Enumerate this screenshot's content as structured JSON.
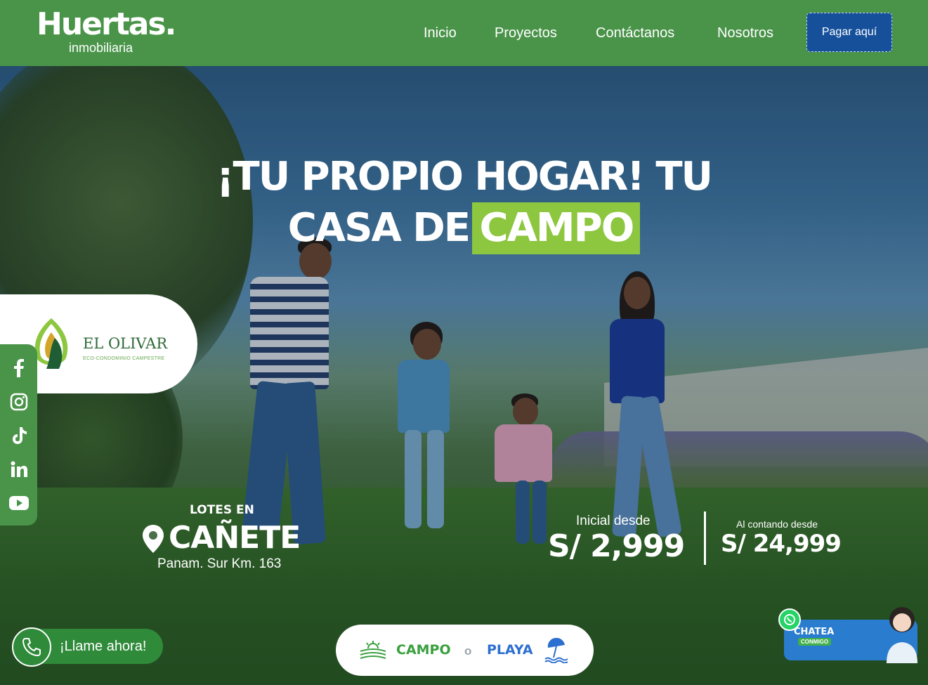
{
  "header": {
    "logo_main": "Huertas.",
    "logo_sub": "inmobiliaria",
    "nav": [
      "Inicio",
      "Proyectos",
      "Contáctanos",
      "Nosotros"
    ],
    "pay_button": "Pagar aquí"
  },
  "hero": {
    "headline_line1": "¡TU PROPIO HOGAR! TU",
    "headline_line2_prefix": "CASA DE",
    "headline_highlight": "CAMPO"
  },
  "project": {
    "name": "EL OLIVAR",
    "subtitle": "ECO-CONDOMINIO CAMPESTRE"
  },
  "social": [
    "facebook-icon",
    "instagram-icon",
    "tiktok-icon",
    "linkedin-icon",
    "youtube-icon"
  ],
  "location": {
    "lotes_label": "LOTES EN",
    "city": "CAÑETE",
    "address": "Panam. Sur Km. 163"
  },
  "prices": {
    "inicial_label": "Inicial desde",
    "inicial_value": "S/ 2,999",
    "contado_label": "Al contando desde",
    "contado_value": "S/ 24,999"
  },
  "call": {
    "label": "¡Llame ahora!"
  },
  "pill": {
    "campo": "CAMPO",
    "o": "o",
    "playa": "PLAYA"
  },
  "chat": {
    "title": "CHATEA",
    "sub": "CONMIGO"
  },
  "colors": {
    "header_green": "#4a944a",
    "pay_blue": "#16509b",
    "highlight_green": "#8dc63f"
  }
}
